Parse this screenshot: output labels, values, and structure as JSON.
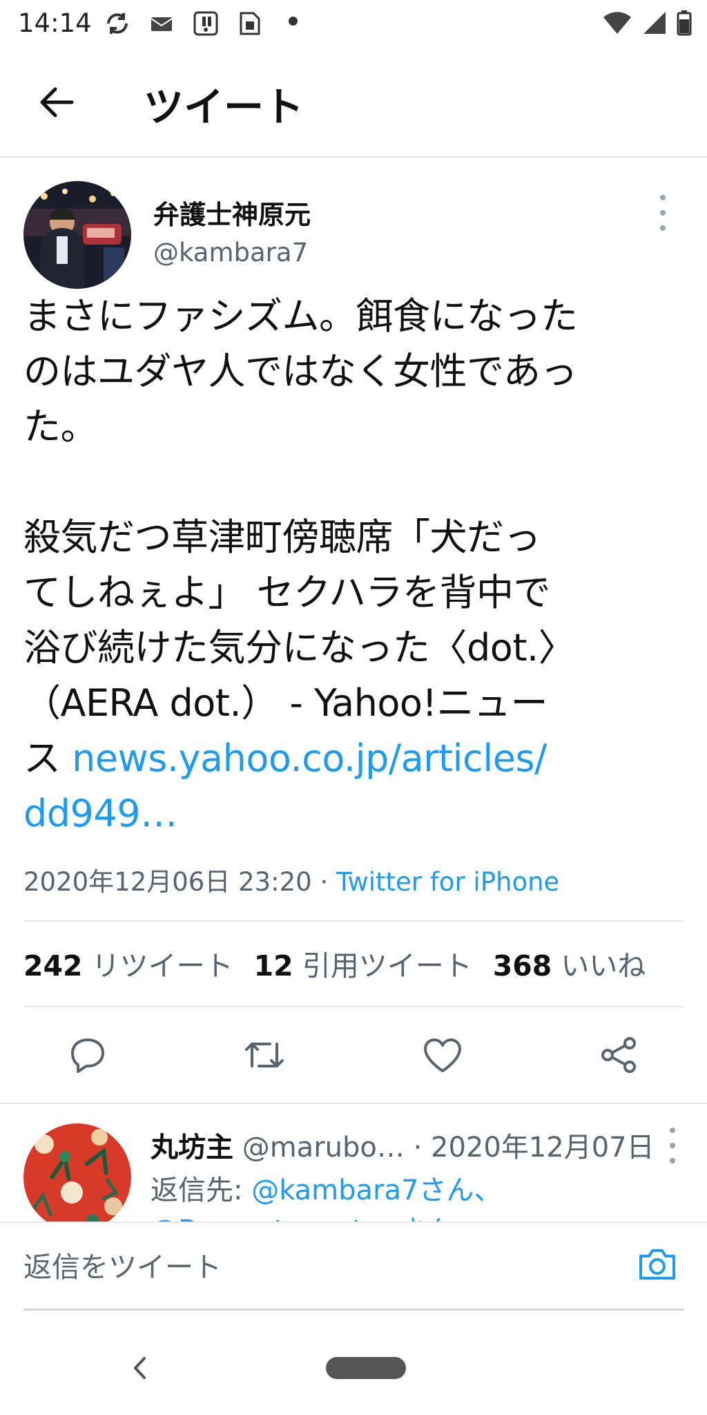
{
  "status_bar": {
    "time": "14:14",
    "icons": [
      "sync-icon",
      "mail-icon",
      "notification-icon",
      "sim-icon"
    ],
    "right_icons": [
      "wifi-icon",
      "signal-icon",
      "battery-icon"
    ]
  },
  "header": {
    "title": "ツイート"
  },
  "tweet": {
    "author_name": "弁護士神原元",
    "author_handle": "@kambara7",
    "lines": [
      "まさにファシズム。餌食になった",
      "のはユダヤ人ではなく女性であっ",
      "た。",
      "",
      "殺気だつ草津町傍聴席「犬だっ",
      "てしねぇよ」 セクハラを背中で",
      "浴び続けた気分になった〈dot.〉",
      "（AERA dot.） - Yahoo!ニュー"
    ],
    "last_line_prefix": "ス ",
    "link_part1": "news.yahoo.co.jp/articles/",
    "link_part2": "dd949…",
    "timestamp": "2020年12月06日 23:20",
    "separator": " · ",
    "source": "Twitter for iPhone"
  },
  "stats": {
    "retweets_count": "242",
    "retweets_label": "リツイート",
    "quotes_count": "12",
    "quotes_label": "引用ツイート",
    "likes_count": "368",
    "likes_label": "いいね"
  },
  "actions": [
    "reply-icon",
    "retweet-icon",
    "like-icon",
    "share-icon"
  ],
  "reply": {
    "name": "丸坊主",
    "handle": "@marubo…",
    "date": " · 2020年12月07日",
    "reply_prefix": "返信先: ",
    "mention1": "@kambara7さん、",
    "mention2": "@Borgzatauvatanさん"
  },
  "compose": {
    "placeholder": "返信をツイート"
  },
  "colors": {
    "link": "#1d9bf0",
    "secondary_text": "#566370",
    "divider": "#e8e8e8"
  }
}
